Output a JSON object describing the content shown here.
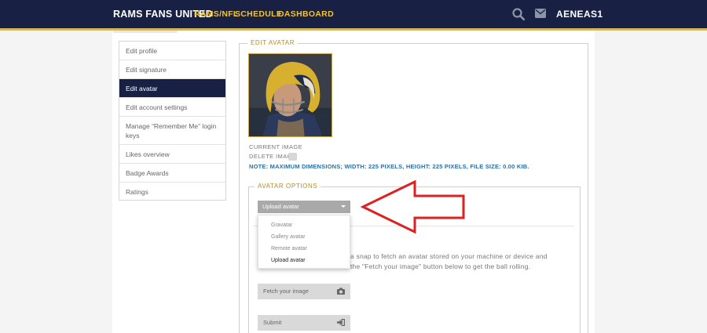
{
  "header": {
    "brand": "RAMS FANS UNITED",
    "nav": [
      "RAMS/NFL",
      "SCHEDULE",
      "DASHBOARD"
    ],
    "icons": [
      "search-icon",
      "mail-icon"
    ],
    "username": "AENEAS1"
  },
  "sidebar": {
    "items": [
      {
        "label": "Edit profile"
      },
      {
        "label": "Edit signature"
      },
      {
        "label": "Edit avatar"
      },
      {
        "label": "Edit account settings"
      },
      {
        "label": "Manage “Remember Me” login keys"
      },
      {
        "label": "Likes overview"
      },
      {
        "label": "Badge Awards"
      },
      {
        "label": "Ratings"
      }
    ],
    "active_index": 2
  },
  "edit_avatar": {
    "legend": "EDIT AVATAR",
    "current_image_label": "CURRENT IMAGE",
    "delete_image_label": "DELETE IMAGE",
    "note": "NOTE:  MAXIMUM DIMENSIONS; WIDTH: 225 PIXELS, HEIGHT: 225 PIXELS, FILE SIZE: 0.00 KIB."
  },
  "avatar_options": {
    "legend": "AVATAR OPTIONS",
    "selected": "Upload avatar",
    "options": [
      "Gravatar",
      "Gallery avatar",
      "Remote avatar",
      "Upload avatar"
    ],
    "description_line1": "a snap to fetch an avatar stored on your machine or device and",
    "description_line2": "the \"Fetch your image\" button below to get the ball rolling.",
    "fetch_button": "Fetch your image",
    "submit_button": "Submit"
  },
  "colors": {
    "navy": "#182143",
    "gold": "#f2c230",
    "stripe": "#d4b45e",
    "annotation_arrow": "#e02020"
  }
}
